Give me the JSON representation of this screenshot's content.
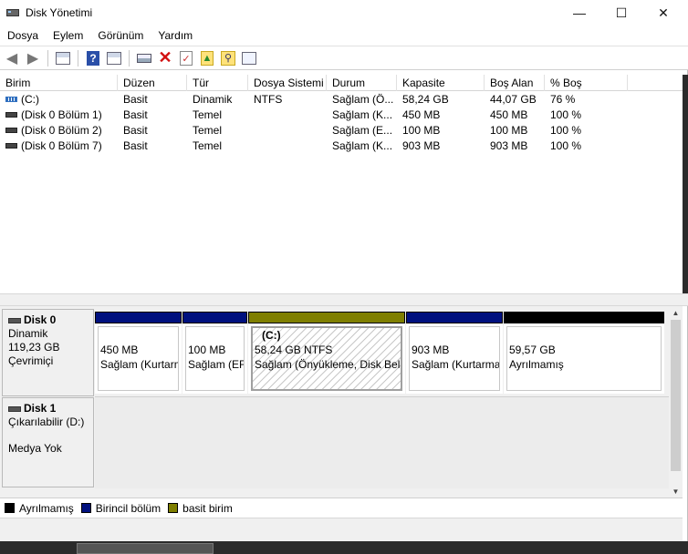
{
  "window": {
    "title": "Disk Yönetimi"
  },
  "title_buttons": {
    "minimize": "—",
    "maximize": "☐",
    "close": "✕"
  },
  "menu": [
    "Dosya",
    "Eylem",
    "Görünüm",
    "Yardım"
  ],
  "table": {
    "columns": [
      "Birim",
      "Düzen",
      "Tür",
      "Dosya Sistemi",
      "Durum",
      "Kapasite",
      "Boş Alan",
      "% Boş"
    ],
    "rows": [
      [
        "(C:)",
        "Basit",
        "Dinamik",
        "NTFS",
        "Sağlam (Ö...",
        "58,24 GB",
        "44,07 GB",
        "76 %"
      ],
      [
        "(Disk 0 Bölüm 1)",
        "Basit",
        "Temel",
        "",
        "Sağlam (K...",
        "450 MB",
        "450 MB",
        "100 %"
      ],
      [
        "(Disk 0 Bölüm 2)",
        "Basit",
        "Temel",
        "",
        "Sağlam (E...",
        "100 MB",
        "100 MB",
        "100 %"
      ],
      [
        "(Disk 0 Bölüm 7)",
        "Basit",
        "Temel",
        "",
        "Sağlam (K...",
        "903 MB",
        "903 MB",
        "100 %"
      ]
    ]
  },
  "disks": [
    {
      "name": "Disk 0",
      "type": "Dinamik",
      "size": "119,23 GB",
      "status": "Çevrimiçi"
    },
    {
      "name": "Disk 1",
      "type": "Çıkarılabilir (D:)",
      "media": "Medya Yok"
    }
  ],
  "partitions": [
    {
      "label": "",
      "size": "450 MB",
      "status": "Sağlam (Kurtarma Bölümü)",
      "color": "#00107e"
    },
    {
      "label": "",
      "size": "100 MB",
      "status": "Sağlam (EFI Sistem Bölümü)",
      "color": "#00107e"
    },
    {
      "label": "(C:)",
      "size": "58,24 GB NTFS",
      "status": "Sağlam (Önyükleme, Disk Belleği Dosyası)",
      "color": "#7f7f00"
    },
    {
      "label": "",
      "size": "903 MB",
      "status": "Sağlam (Kurtarma Bölümü)",
      "color": "#00107e"
    },
    {
      "label": "",
      "size": "59,57 GB",
      "status": "Ayrılmamış",
      "color": "#000000"
    }
  ],
  "legend": [
    {
      "label": "Ayrılmamış",
      "color": "#000000"
    },
    {
      "label": "Birincil bölüm",
      "color": "#00107e"
    },
    {
      "label": "basit birim",
      "color": "#7f7f00"
    }
  ]
}
